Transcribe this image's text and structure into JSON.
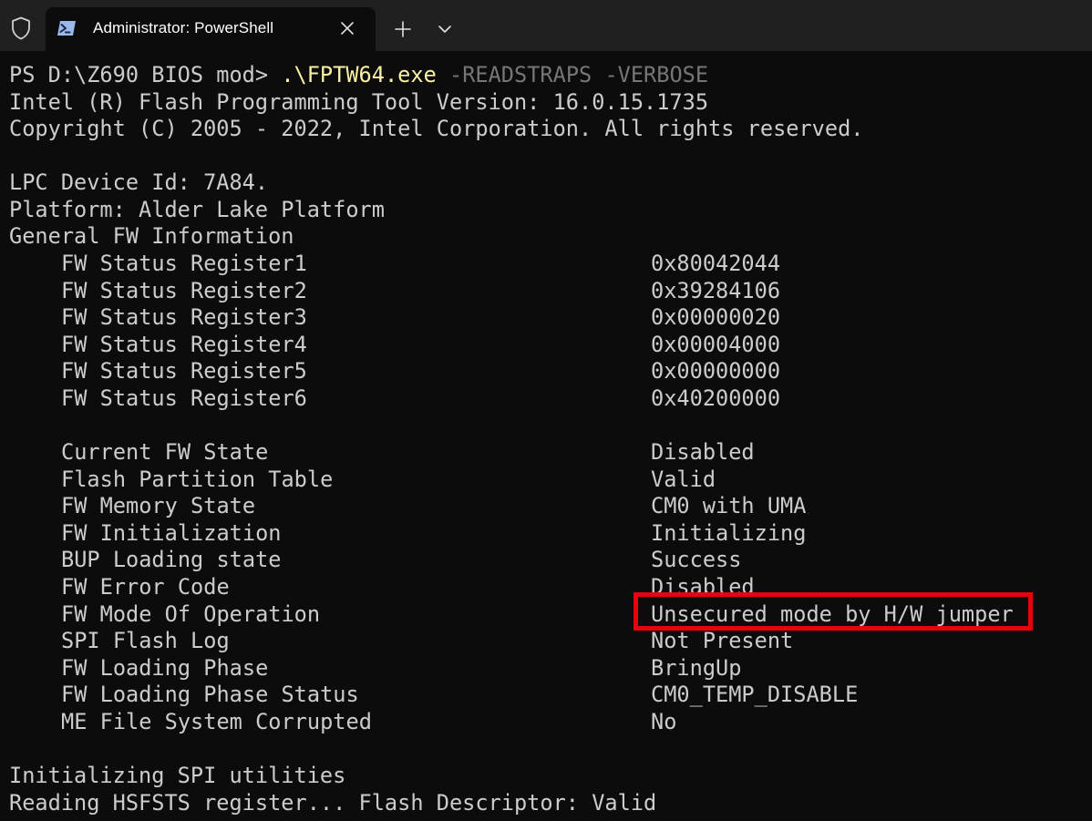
{
  "window": {
    "tab_title": "Administrator: PowerShell",
    "icons": {
      "shield": "shield-icon",
      "powershell": "powershell-icon",
      "close": "close-icon",
      "new_tab": "plus-icon",
      "menu": "chevron-down-icon"
    },
    "close_glyph": "✕",
    "new_tab_glyph": "+",
    "colors": {
      "titlebar": "#202020",
      "terminal_bg": "#0c0c0c",
      "text": "#cccccc",
      "command": "#f9f1a5",
      "argument": "#767676",
      "highlight": "#e8000b"
    }
  },
  "terminal": {
    "prompt": "PS D:\\Z690 BIOS mod> ",
    "command_exe": ".\\FPTW64.exe",
    "command_args": " -READSTRAPS -VERBOSE",
    "header_lines": [
      "Intel (R) Flash Programming Tool Version: 16.0.15.1735",
      "Copyright (C) 2005 - 2022, Intel Corporation. All rights reserved."
    ],
    "device_lines": [
      "LPC Device Id: 7A84.",
      "Platform: Alder Lake Platform",
      "General FW Information"
    ],
    "status_registers": [
      {
        "label": "FW Status Register1",
        "value": "0x80042044"
      },
      {
        "label": "FW Status Register2",
        "value": "0x39284106"
      },
      {
        "label": "FW Status Register3",
        "value": "0x00000020"
      },
      {
        "label": "FW Status Register4",
        "value": "0x00004000"
      },
      {
        "label": "FW Status Register5",
        "value": "0x00000000"
      },
      {
        "label": "FW Status Register6",
        "value": "0x40200000"
      }
    ],
    "fw_info": [
      {
        "label": "Current FW State",
        "value": "Disabled"
      },
      {
        "label": "Flash Partition Table",
        "value": "Valid"
      },
      {
        "label": "FW Memory State",
        "value": "CM0 with UMA"
      },
      {
        "label": "FW Initialization",
        "value": "Initializing"
      },
      {
        "label": "BUP Loading state",
        "value": "Success"
      },
      {
        "label": "FW Error Code",
        "value": "Disabled"
      },
      {
        "label": "FW Mode Of Operation",
        "value": "Unsecured mode by H/W jumper"
      },
      {
        "label": "SPI Flash Log",
        "value": "Not Present"
      },
      {
        "label": "FW Loading Phase",
        "value": "BringUp"
      },
      {
        "label": "FW Loading Phase Status",
        "value": "CM0_TEMP_DISABLE"
      },
      {
        "label": "ME File System Corrupted",
        "value": "No"
      }
    ],
    "footer_lines": [
      "Initializing SPI utilities",
      "Reading HSFSTS register... Flash Descriptor: Valid"
    ]
  }
}
